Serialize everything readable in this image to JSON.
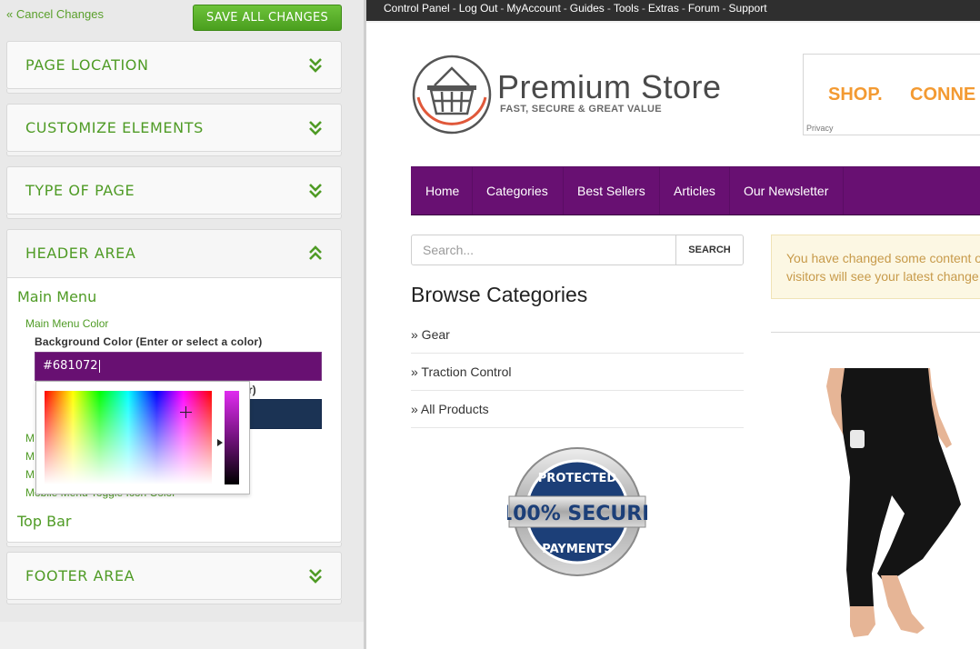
{
  "editor": {
    "cancel_label": "« Cancel Changes",
    "save_label": "SAVE ALL CHANGES",
    "sections": {
      "page_location": "PAGE LOCATION",
      "customize_elements": "CUSTOMIZE ELEMENTS",
      "type_of_page": "TYPE OF PAGE",
      "header_area": "HEADER AREA",
      "footer_area": "FOOTER AREA"
    },
    "header": {
      "main_menu": "Main Menu",
      "main_menu_color": "Main Menu Color",
      "bg_color_label": "Background Color (Enter or select a color)",
      "bg_color_value": "#681072",
      "bg_color_hex": "#681072",
      "second_label_partial": "r)",
      "second_value_hex": "#1b3354",
      "partial_m": [
        "M",
        "M",
        "M"
      ],
      "toggle_icon_color": "Mobile Menu Toggle Icon Color",
      "top_bar": "Top Bar"
    },
    "accent_color": "#4f9b25"
  },
  "preview": {
    "top_links": [
      "Control Panel",
      "Log Out",
      "MyAccount",
      "Guides",
      "Tools",
      "Extras",
      "Forum",
      "Support"
    ],
    "brand_name": "Premium Store",
    "tagline": "FAST, SECURE & GREAT VALUE",
    "ad": {
      "shop": "SHOP.",
      "connect": "CONNE",
      "privacy": "Privacy"
    },
    "nav": [
      "Home",
      "Categories",
      "Best Sellers",
      "Articles",
      "Our Newsletter"
    ],
    "nav_color": "#681072",
    "search_placeholder": "Search...",
    "search_button": "SEARCH",
    "browse_title": "Browse Categories",
    "categories": [
      "» Gear",
      "» Traction Control",
      "» All Products"
    ],
    "notice_line1": "You have changed some content o",
    "notice_line2": "visitors will see your latest change",
    "badge": {
      "top": "PROTECTED",
      "middle": "100% SECURE",
      "bottom": "PAYMENTS"
    }
  }
}
